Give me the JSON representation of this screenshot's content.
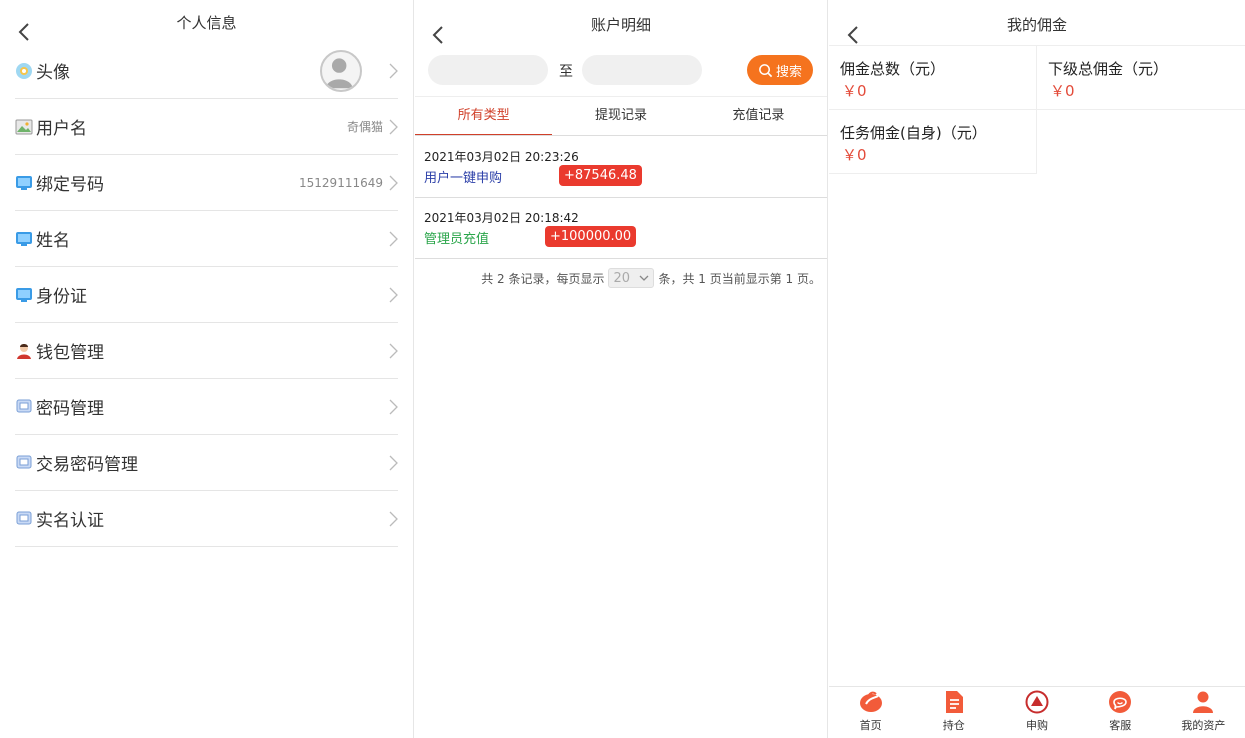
{
  "profile": {
    "title": "个人信息",
    "rows": [
      {
        "label": "头像",
        "value": ""
      },
      {
        "label": "用户名",
        "value": "奇偶猫"
      },
      {
        "label": "绑定号码",
        "value": "15129111649"
      },
      {
        "label": "姓名",
        "value": ""
      },
      {
        "label": "身份证",
        "value": ""
      },
      {
        "label": "钱包管理",
        "value": ""
      },
      {
        "label": "密码管理",
        "value": ""
      },
      {
        "label": "交易密码管理",
        "value": ""
      },
      {
        "label": "实名认证",
        "value": ""
      }
    ]
  },
  "account": {
    "title": "账户明细",
    "to_label": "至",
    "search_label": "搜索",
    "tabs": [
      "所有类型",
      "提现记录",
      "充值记录"
    ],
    "active_tab": 0,
    "records": [
      {
        "time": "2021年03月02日 20:23:26",
        "type": "用户一键申购",
        "amount": "+87546.48",
        "type_color": "#2b3fa8"
      },
      {
        "time": "2021年03月02日 20:18:42",
        "type": "管理员充值",
        "amount": "+100000.00",
        "type_color": "#2aa54a"
      }
    ],
    "pager": {
      "prefix": "共 2 条记录，每页显示",
      "page_size": "20",
      "suffix": "条，共 1 页当前显示第 1 页。"
    }
  },
  "commission": {
    "title": "我的佣金",
    "cells": [
      {
        "label": "佣金总数（元）",
        "value": "￥0"
      },
      {
        "label": "下级总佣金（元）",
        "value": "￥0"
      },
      {
        "label": "任务佣金(自身)（元）",
        "value": "￥0"
      }
    ],
    "tabbar": [
      {
        "label": "首页",
        "icon": "home-icon"
      },
      {
        "label": "持仓",
        "icon": "document-icon"
      },
      {
        "label": "申购",
        "icon": "triangle-icon"
      },
      {
        "label": "客服",
        "icon": "chat-icon"
      },
      {
        "label": "我的资产",
        "icon": "user-icon"
      }
    ],
    "accent": "#f25b3a"
  }
}
